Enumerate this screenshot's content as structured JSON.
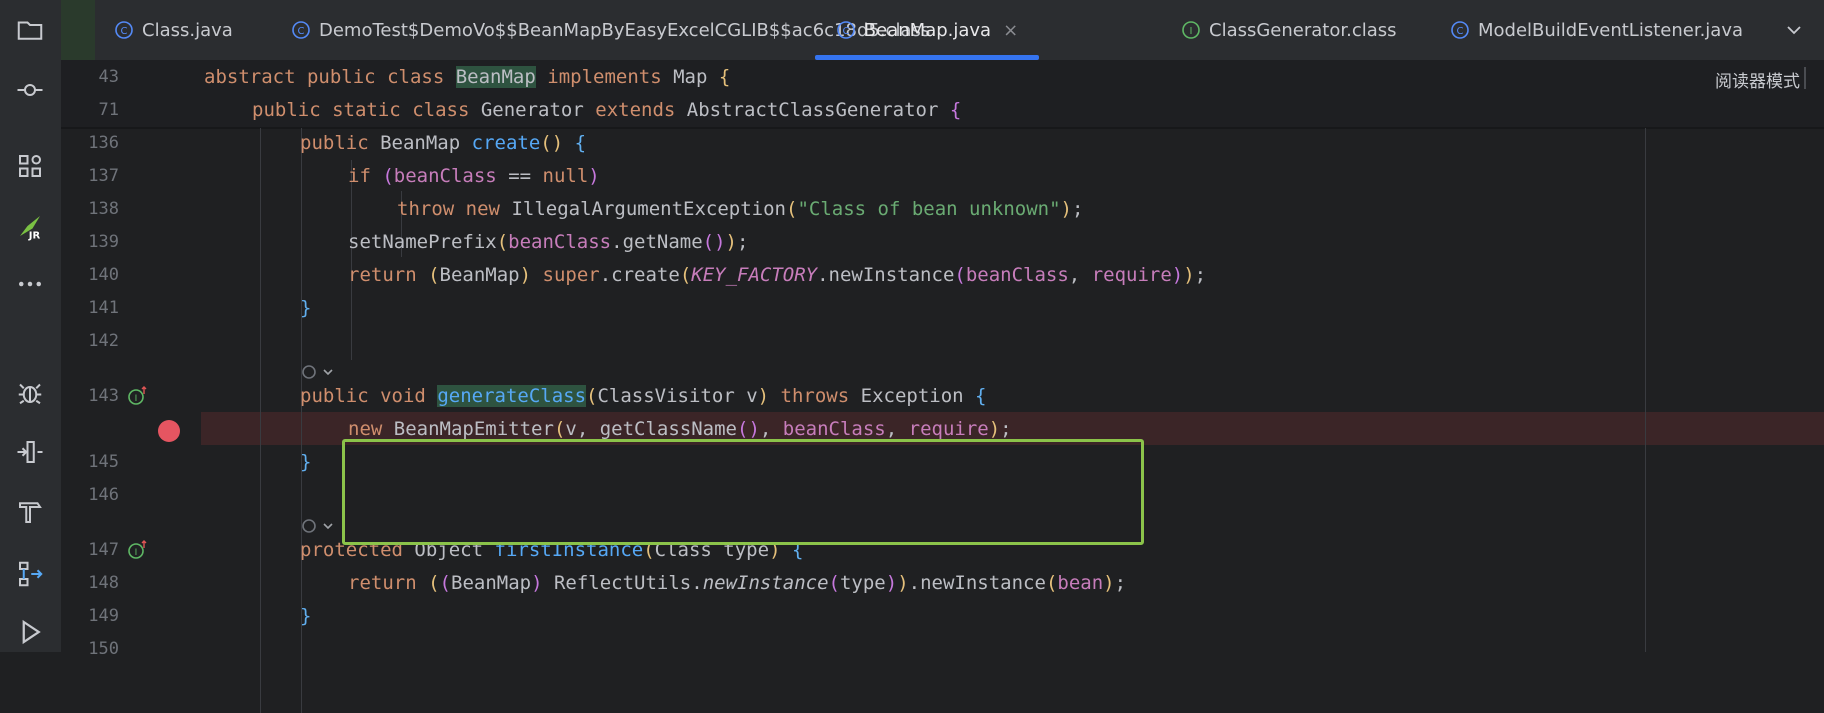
{
  "tabs": [
    {
      "label": "Class.java",
      "icon": "class-icon",
      "active": false
    },
    {
      "label": "DemoTest$DemoVo$$BeanMapByEasyExcelCGLIB$$ac6c18d5.class",
      "icon": "class-icon",
      "active": false
    },
    {
      "label": "BeanMap.java",
      "icon": "class-icon",
      "active": true
    },
    {
      "label": "ClassGenerator.class",
      "icon": "interface-icon",
      "active": false
    },
    {
      "label": "ModelBuildEventListener.java",
      "icon": "class-icon",
      "active": false
    }
  ],
  "tab_close": "×",
  "reader_mode": "阅读器模式",
  "sticky_lines": [
    {
      "num": "43"
    },
    {
      "num": "71"
    }
  ],
  "lines": [
    {
      "num": "136"
    },
    {
      "num": "137"
    },
    {
      "num": "138"
    },
    {
      "num": "139"
    },
    {
      "num": "140"
    },
    {
      "num": "141"
    },
    {
      "num": "142"
    },
    {
      "num": "143"
    },
    {
      "num": ""
    },
    {
      "num": "145"
    },
    {
      "num": "146"
    },
    {
      "num": "147"
    },
    {
      "num": "148"
    },
    {
      "num": "149"
    },
    {
      "num": "150"
    }
  ],
  "code": {
    "l43": {
      "abstract": "abstract",
      "public": "public",
      "class": "class",
      "name": "BeanMap",
      "implements": "implements",
      "iface": "Map",
      "brace": "{"
    },
    "l71": {
      "public": "public",
      "static": "static",
      "class": "class",
      "name": "Generator",
      "extends": "extends",
      "parent": "AbstractClassGenerator",
      "brace": "{"
    },
    "l136": {
      "public": "public",
      "type": "BeanMap",
      "fn": "create",
      "paren": "()",
      "brace": "{"
    },
    "l137": {
      "if": "if",
      "open": "(",
      "fld": "beanClass",
      "op": " == ",
      "null": "null",
      "close": ")"
    },
    "l138": {
      "throw": "throw",
      "new": "new",
      "type": "IllegalArgumentException",
      "open": "(",
      "str": "\"Class of bean unknown\"",
      "close": ")",
      "end": ";"
    },
    "l139": {
      "fn": "setNamePrefix",
      "open": "(",
      "fld": "beanClass",
      "call": ".getName",
      "p": "()",
      "close": ")",
      "end": ";"
    },
    "l140": {
      "return": "return",
      "cast_open": "(",
      "cast": "BeanMap",
      "cast_close": ")",
      "super": "super",
      "create": ".create",
      "o1": "(",
      "const": "KEY_FACTORY",
      "ni": ".newInstance",
      "o2": "(",
      "f1": "beanClass",
      "comma": ", ",
      "f2": "require",
      "c2": ")",
      "c1": ")",
      "end": ";"
    },
    "l141": {
      "brace": "}"
    },
    "l143": {
      "public": "public",
      "void": "void",
      "fn": "generateClass",
      "open": "(",
      "params": "ClassVisitor v",
      "close": ")",
      "throws": "throws",
      "ex": "Exception",
      "brace": "{"
    },
    "l144": {
      "new": "new",
      "type": "BeanMapEmitter",
      "open": "(",
      "v": "v, ",
      "call": "getClassName",
      "p": "()",
      "comma1": ", ",
      "f1": "beanClass",
      "comma2": ", ",
      "f2": "require",
      "close": ")",
      "end": ";"
    },
    "l145": {
      "brace": "}"
    },
    "l147": {
      "protected": "protected",
      "type": "Object",
      "fn": "firstInstance",
      "open": "(",
      "params": "Class type",
      "close": ")",
      "brace": "{"
    },
    "l148": {
      "return": "return",
      "o1": "(",
      "o2": "(",
      "cast": "BeanMap",
      "c2": ")",
      "util": " ReflectUtils.",
      "ni": "newInstance",
      "o3": "(",
      "arg": "type",
      "c3": ")",
      "c1": ")",
      "ni2": ".newInstance",
      "o4": "(",
      "fld": "bean",
      "c4": ")",
      "end": ";"
    },
    "l149": {
      "brace": "}"
    }
  },
  "colors": {
    "keyword": "#cf8e6d",
    "function": "#56a8f5",
    "field": "#c77dbb",
    "string": "#6aab73",
    "breakpoint": "#e55561",
    "selection_box": "#8bc34a",
    "active_tab": "#3574f0"
  }
}
